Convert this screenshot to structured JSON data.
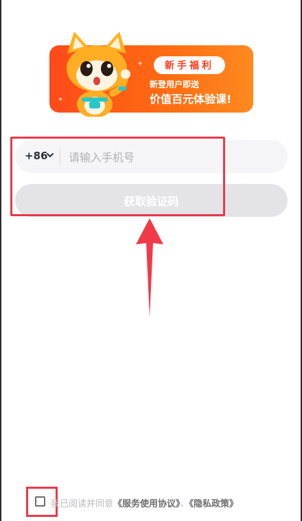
{
  "banner": {
    "badge": "新手福利",
    "line1": "新登用户即送",
    "line2": "价值百元体验课!"
  },
  "login": {
    "country_code": "+86",
    "phone_placeholder": "请输入手机号",
    "get_code_label": "获取验证码"
  },
  "agreement": {
    "prefix": "我已阅读并同意",
    "service_link": "《服务使用协议》",
    "separator": "、",
    "privacy_link": "《隐私政策》"
  },
  "colors": {
    "banner_orange": "#ff5a14",
    "highlight_red": "#e8394b",
    "button_disabled": "#e4e4e6"
  }
}
